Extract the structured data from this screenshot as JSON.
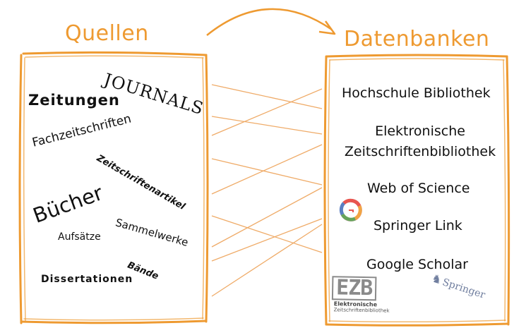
{
  "headings": {
    "left": "Quellen",
    "right": "Datenbanken"
  },
  "sources": [
    "JOURNALS",
    "Zeitungen",
    "Fachzeitschriften",
    "Zeitschriftenartikel",
    "Bücher",
    "Sammelwerke",
    "Aufsätze",
    "Bände",
    "Dissertationen"
  ],
  "databases": {
    "hochschule": "Hochschule Bibliothek",
    "ezb_line1": "Elektronische",
    "ezb_line2": "Zeitschriftenbibliothek",
    "wos": "Web of Science",
    "springer": "Springer Link",
    "scholar": "Google Scholar"
  },
  "logos": {
    "ezb_word": "EZB",
    "ezb_line1": "Elektronische",
    "ezb_line2": "Zeitschriftenbibliothek",
    "springer": "Springer"
  },
  "colors": {
    "accent": "#ee9a31",
    "text": "#111111"
  }
}
